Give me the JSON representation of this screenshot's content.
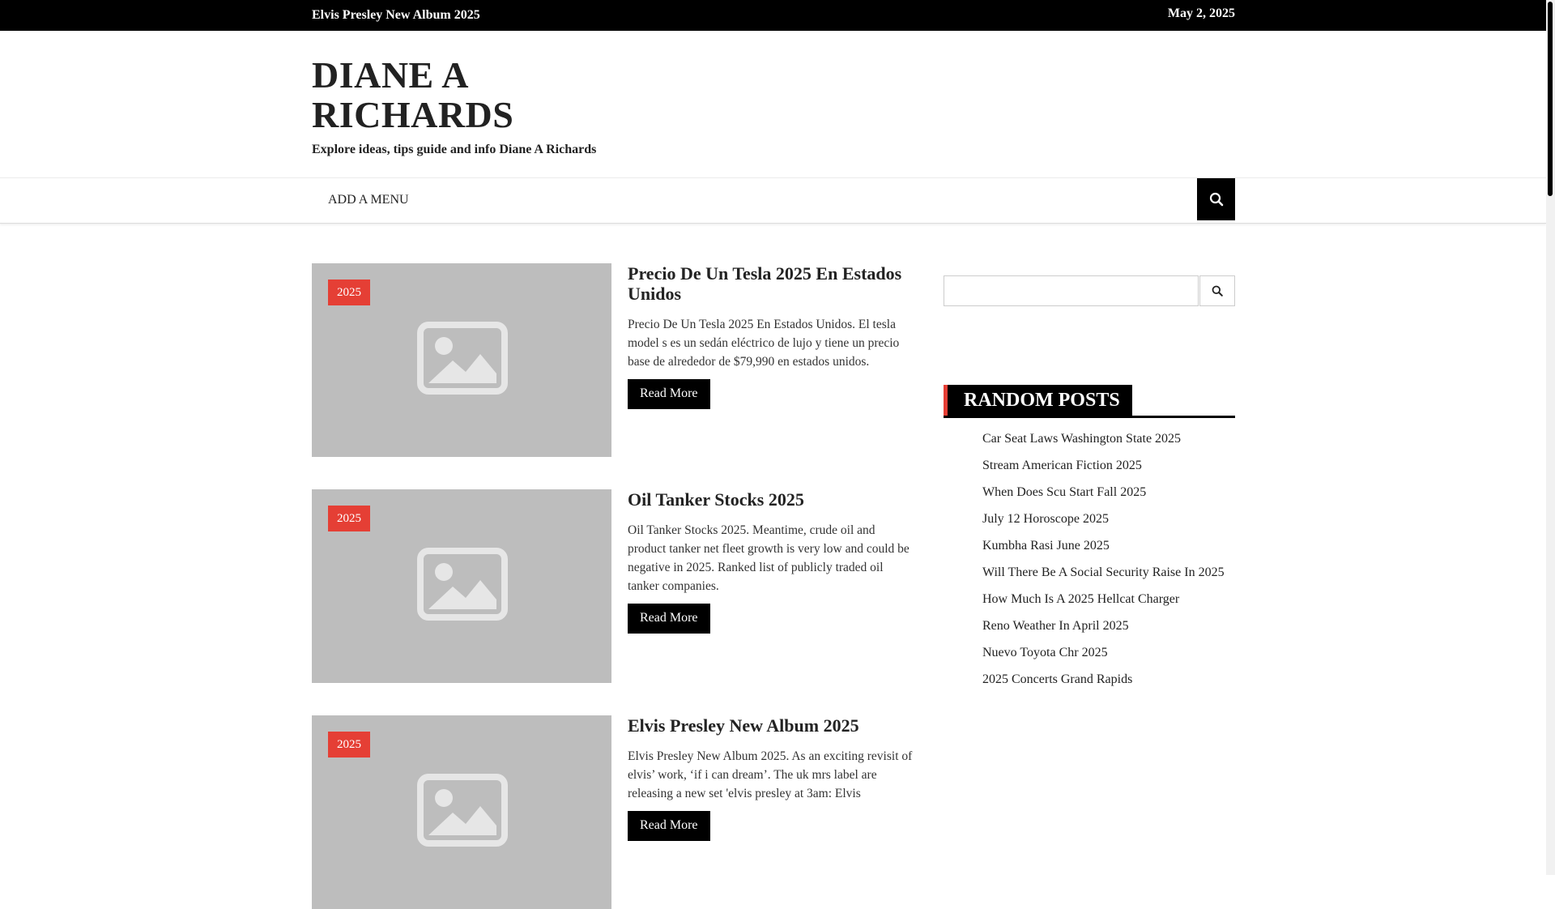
{
  "topbar": {
    "ticker": "Elvis Presley New Album 2025",
    "date": "May 2, 2025"
  },
  "site": {
    "title": "DIANE A RICHARDS",
    "tagline": "Explore ideas, tips guide and info Diane A Richards"
  },
  "nav": {
    "menu_label": "ADD A MENU",
    "search_icon": "search-icon"
  },
  "posts": [
    {
      "tag": "2025",
      "title": "Precio De Un Tesla 2025 En Estados Unidos",
      "excerpt": "Precio De Un Tesla 2025 En Estados Unidos. El tesla model s es un sedán eléctrico de lujo y tiene un precio base de alrededor de $79,990 en estados unidos.",
      "button": "Read More"
    },
    {
      "tag": "2025",
      "title": "Oil Tanker Stocks 2025",
      "excerpt": "Oil Tanker Stocks 2025. Meantime, crude oil and product tanker net fleet growth is very low and could be negative in 2025. Ranked list of publicly traded oil tanker companies.",
      "button": "Read More"
    },
    {
      "tag": "2025",
      "title": "Elvis Presley New Album 2025",
      "excerpt": "Elvis Presley New Album 2025. As an exciting revisit of elvis’ work, ‘if i can dream’. The uk mrs label are releasing a new set 'elvis presley at 3am: Elvis",
      "button": "Read More"
    }
  ],
  "sidebar": {
    "search_placeholder": "",
    "widget_title": "RANDOM POSTS",
    "random_posts": [
      "Car Seat Laws Washington State 2025",
      "Stream American Fiction 2025",
      "When Does Scu Start Fall 2025",
      "July 12 Horoscope 2025",
      "Kumbha Rasi June 2025",
      "Will There Be A Social Security Raise In 2025",
      "How Much Is A 2025 Hellcat Charger",
      "Reno Weather In April 2025",
      "Nuevo Toyota Chr 2025",
      "2025 Concerts Grand Rapids"
    ]
  },
  "colors": {
    "accent": "#e53f35",
    "dark": "#000000",
    "placeholder_bg": "#bdbdbd"
  }
}
